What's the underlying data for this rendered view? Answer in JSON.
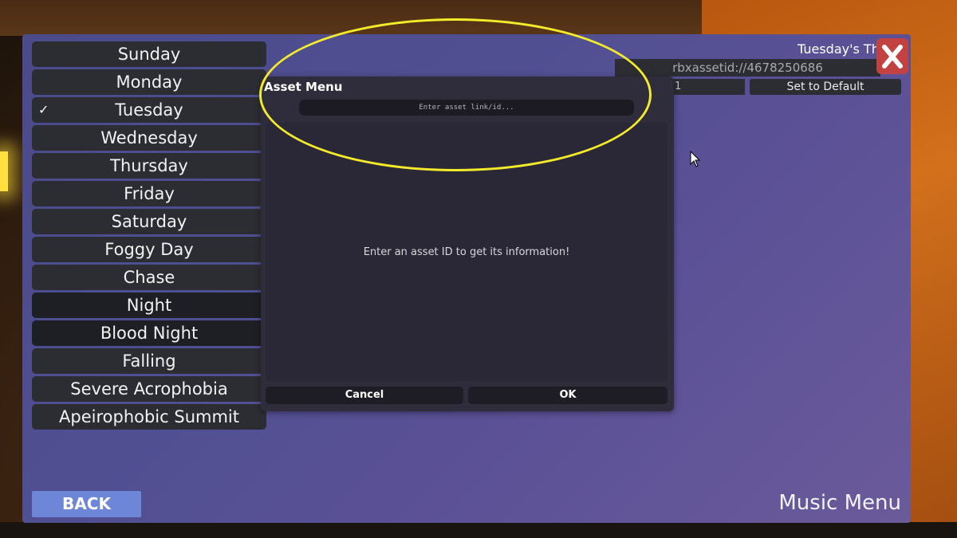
{
  "sidebar": {
    "items": [
      {
        "label": "Sunday",
        "selected": false
      },
      {
        "label": "Monday",
        "selected": false
      },
      {
        "label": "Tuesday",
        "selected": true
      },
      {
        "label": "Wednesday",
        "selected": false
      },
      {
        "label": "Thursday",
        "selected": false
      },
      {
        "label": "Friday",
        "selected": false
      },
      {
        "label": "Saturday",
        "selected": false
      },
      {
        "label": "Foggy Day",
        "selected": false
      },
      {
        "label": "Chase",
        "selected": false
      },
      {
        "label": "Night",
        "selected": false
      },
      {
        "label": "Blood Night",
        "selected": false
      },
      {
        "label": "Falling",
        "selected": false
      },
      {
        "label": "Severe Acrophobia",
        "selected": false
      },
      {
        "label": "Apeirophobic Summit",
        "selected": false
      }
    ],
    "check_mark": "✓"
  },
  "footer": {
    "back_label": "BACK",
    "menu_title": "Music Menu"
  },
  "detail": {
    "song_title": "Tuesday's Th",
    "asset_id": "rbxassetid://4678250686",
    "small_value": "1",
    "set_default_label": "Set to Default",
    "close_icon": "close-icon"
  },
  "dialog": {
    "title": "Asset Menu",
    "input_placeholder": "Enter asset link/id...",
    "input_value": "",
    "message": "Enter an asset ID to get its information!",
    "cancel_label": "Cancel",
    "ok_label": "OK"
  },
  "colors": {
    "panel": "#4f4f92",
    "button_dark": "#2c2d33",
    "back_button": "#6e86d8",
    "close_button": "#c24242",
    "highlight": "#f2ea2a"
  }
}
